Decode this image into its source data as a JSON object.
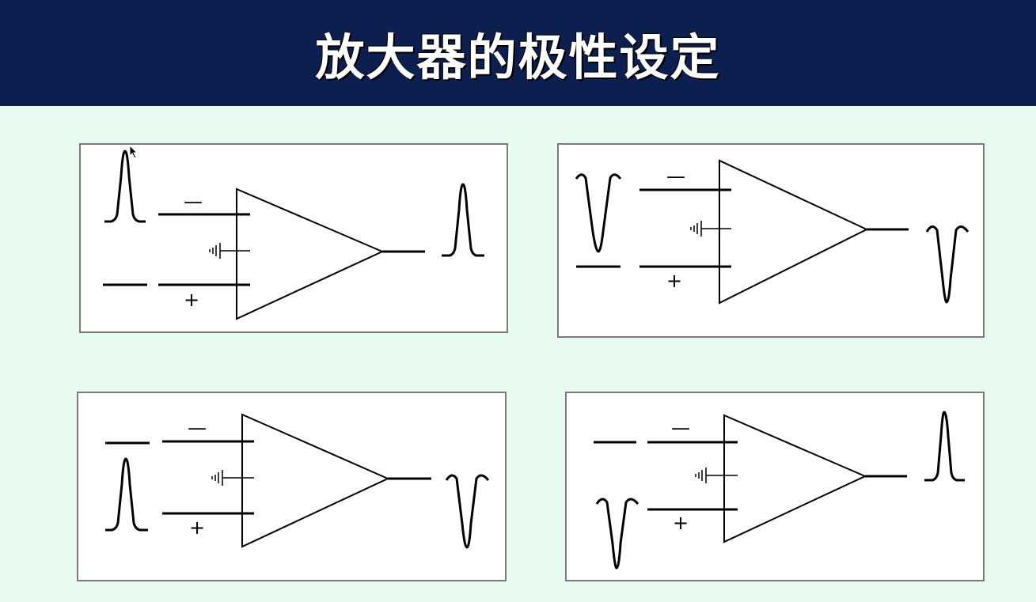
{
  "title": "放大器的极性设定",
  "sign_minus": "—",
  "sign_plus": "+",
  "colors": {
    "header_bg": "#0d1f4f",
    "page_bg": "#e8fbf1",
    "panel_bg": "#ffffff",
    "line": "#000000",
    "panel_border": "#7a7a7a"
  },
  "panels": [
    {
      "minus_input": "positive-pulse",
      "plus_input": "flat",
      "output": "positive-pulse"
    },
    {
      "minus_input": "negative-pulse",
      "plus_input": "flat",
      "output": "negative-pulse"
    },
    {
      "minus_input": "flat",
      "plus_input": "positive-pulse",
      "output": "negative-pulse"
    },
    {
      "minus_input": "flat",
      "plus_input": "negative-pulse",
      "output": "positive-pulse"
    }
  ]
}
